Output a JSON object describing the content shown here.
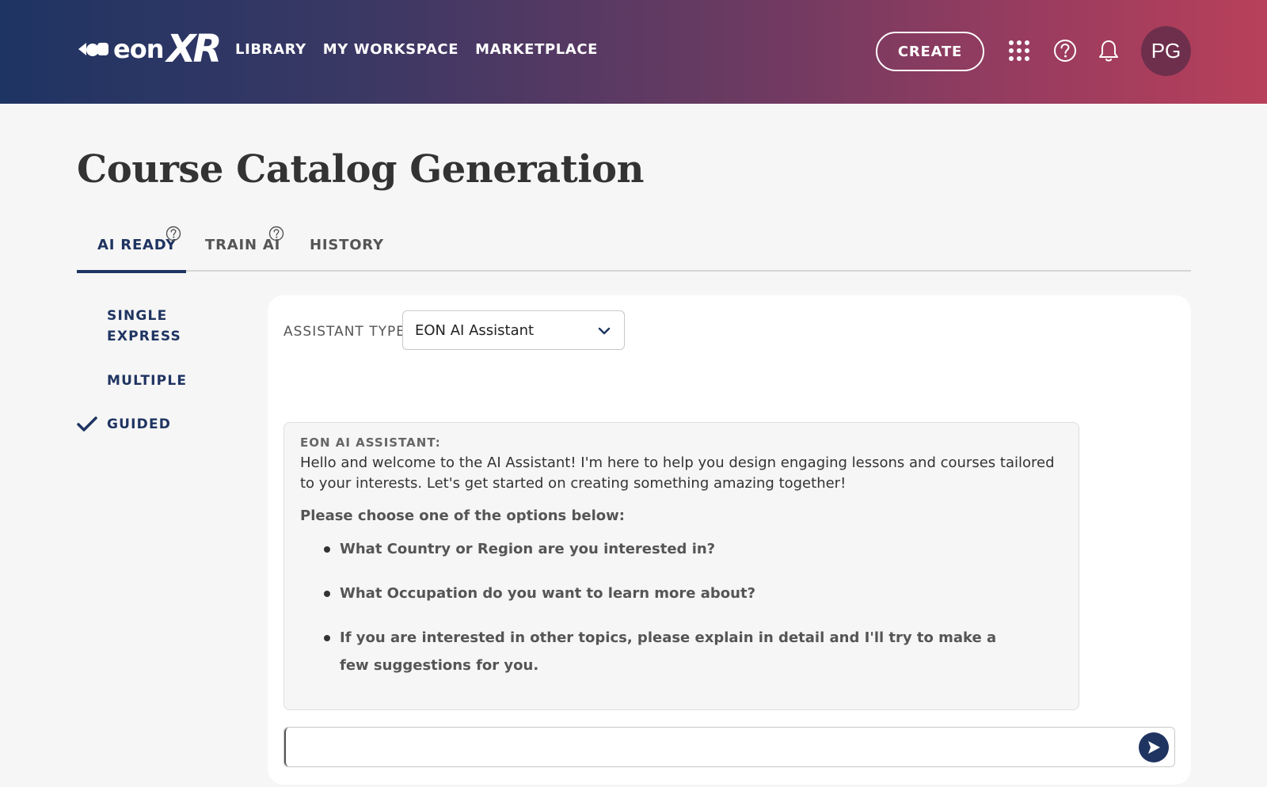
{
  "header": {
    "logo_eon": "eon",
    "logo_xr": "XR",
    "nav": [
      "LIBRARY",
      "MY WORKSPACE",
      "MARKETPLACE"
    ],
    "create_label": "CREATE",
    "avatar_initials": "PG",
    "icons": [
      "apps-grid-icon",
      "help-icon",
      "bell-icon"
    ]
  },
  "page": {
    "title": "Course Catalog Generation"
  },
  "tabs": [
    {
      "label": "AI READY",
      "active": true,
      "help": true
    },
    {
      "label": "TRAIN AI",
      "active": false,
      "help": true
    },
    {
      "label": "HISTORY",
      "active": false,
      "help": false
    }
  ],
  "side_menu": {
    "items": [
      {
        "label": "SINGLE EXPRESS",
        "selected": false
      },
      {
        "label": "MULTIPLE",
        "selected": false
      },
      {
        "label": "GUIDED",
        "selected": true
      }
    ]
  },
  "assistant": {
    "type_label": "ASSISTANT TYPE",
    "selected": "EON AI Assistant"
  },
  "message": {
    "sender": "EON AI ASSISTANT:",
    "intro": "Hello and welcome to the AI Assistant! I'm here to help you design engaging lessons and courses tailored to your interests. Let's get started on creating something amazing together!",
    "prompt": "Please choose one of the options below:",
    "options": [
      "What Country or Region are you interested in?",
      "What Occupation do you want to learn more about?",
      "If you are interested in other topics, please explain in detail and I'll try to make a few suggestions for you."
    ]
  },
  "chat": {
    "input_value": "",
    "placeholder": ""
  },
  "colors": {
    "brand_navy": "#1f3461",
    "header_gradient_start": "#1e3463",
    "header_gradient_end": "#b8405a",
    "avatar_bg": "#6e2f4c"
  }
}
